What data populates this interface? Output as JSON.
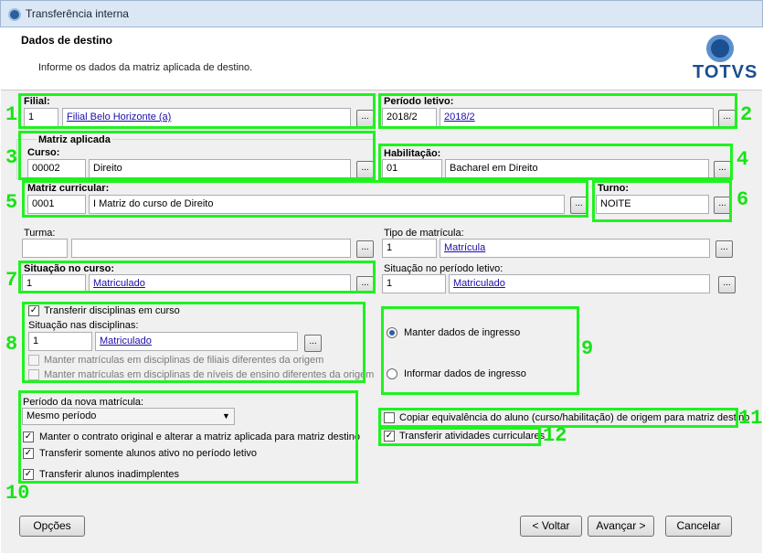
{
  "window": {
    "title": "Transferência interna"
  },
  "header": {
    "title": "Dados de destino",
    "subtitle": "Informe os dados da matriz aplicada de destino.",
    "logo": "TOTVS"
  },
  "fields": {
    "filial": {
      "label": "Filial:",
      "code": "1",
      "name": "Filial Belo Horizonte (a)"
    },
    "periodo_letivo": {
      "label": "Período letivo:",
      "code": "2018/2",
      "name": "2018/2"
    },
    "matriz_aplicada": {
      "group": "Matriz aplicada",
      "curso_label": "Curso:",
      "curso_code": "00002",
      "curso_name": "Direito"
    },
    "habilitacao": {
      "label": "Habilitação:",
      "code": "01",
      "name": "Bacharel em Direito"
    },
    "matriz_curricular": {
      "label": "Matriz curricular:",
      "code": "0001",
      "name": "I Matriz do curso de Direito"
    },
    "turno": {
      "label": "Turno:",
      "value": "NOITE"
    },
    "turma": {
      "label": "Turma:",
      "code": "",
      "name": ""
    },
    "tipo_matricula": {
      "label": "Tipo de matrícula:",
      "code": "1",
      "name": "Matrícula"
    },
    "situacao_curso": {
      "label": "Situação no curso:",
      "code": "1",
      "name": "Matriculado"
    },
    "situacao_periodo": {
      "label": "Situação no período letivo:",
      "code": "1",
      "name": "Matriculado"
    }
  },
  "disciplinas": {
    "transferir_label": "Transferir disciplinas em curso",
    "situacao_label": "Situação nas disciplinas:",
    "situacao_code": "1",
    "situacao_name": "Matriculado",
    "manter_filiais": "Manter matrículas em disciplinas de filiais diferentes da origem",
    "manter_niveis": "Manter matrículas em disciplinas de níveis de ensino diferentes da origem"
  },
  "ingresso": {
    "manter": "Manter dados de ingresso",
    "informar": "Informar dados de ingresso"
  },
  "nova_matricula": {
    "periodo_label": "Período da nova matrícula:",
    "periodo_value": "Mesmo período",
    "manter_contrato": "Manter o contrato original e alterar a matriz aplicada para matriz destino",
    "somente_ativos": "Transferir somente alunos ativo no período letivo",
    "inadimplentes": "Transferir alunos inadimplentes"
  },
  "options": {
    "copiar_equivalencia": "Copiar equivalência do aluno (curso/habilitação) de origem para matriz destino",
    "transferir_atividades": "Transferir atividades curriculares"
  },
  "ellipsis": "...",
  "check_mark": "✓",
  "dropdown_arrow": "▼",
  "annotations": [
    "1",
    "2",
    "3",
    "4",
    "5",
    "6",
    "7",
    "8",
    "9",
    "10",
    "11",
    "12"
  ],
  "annotation_color": "#1ff21f",
  "footer": {
    "options": "Opções",
    "back": "< Voltar",
    "next": "Avançar >",
    "cancel": "Cancelar"
  }
}
